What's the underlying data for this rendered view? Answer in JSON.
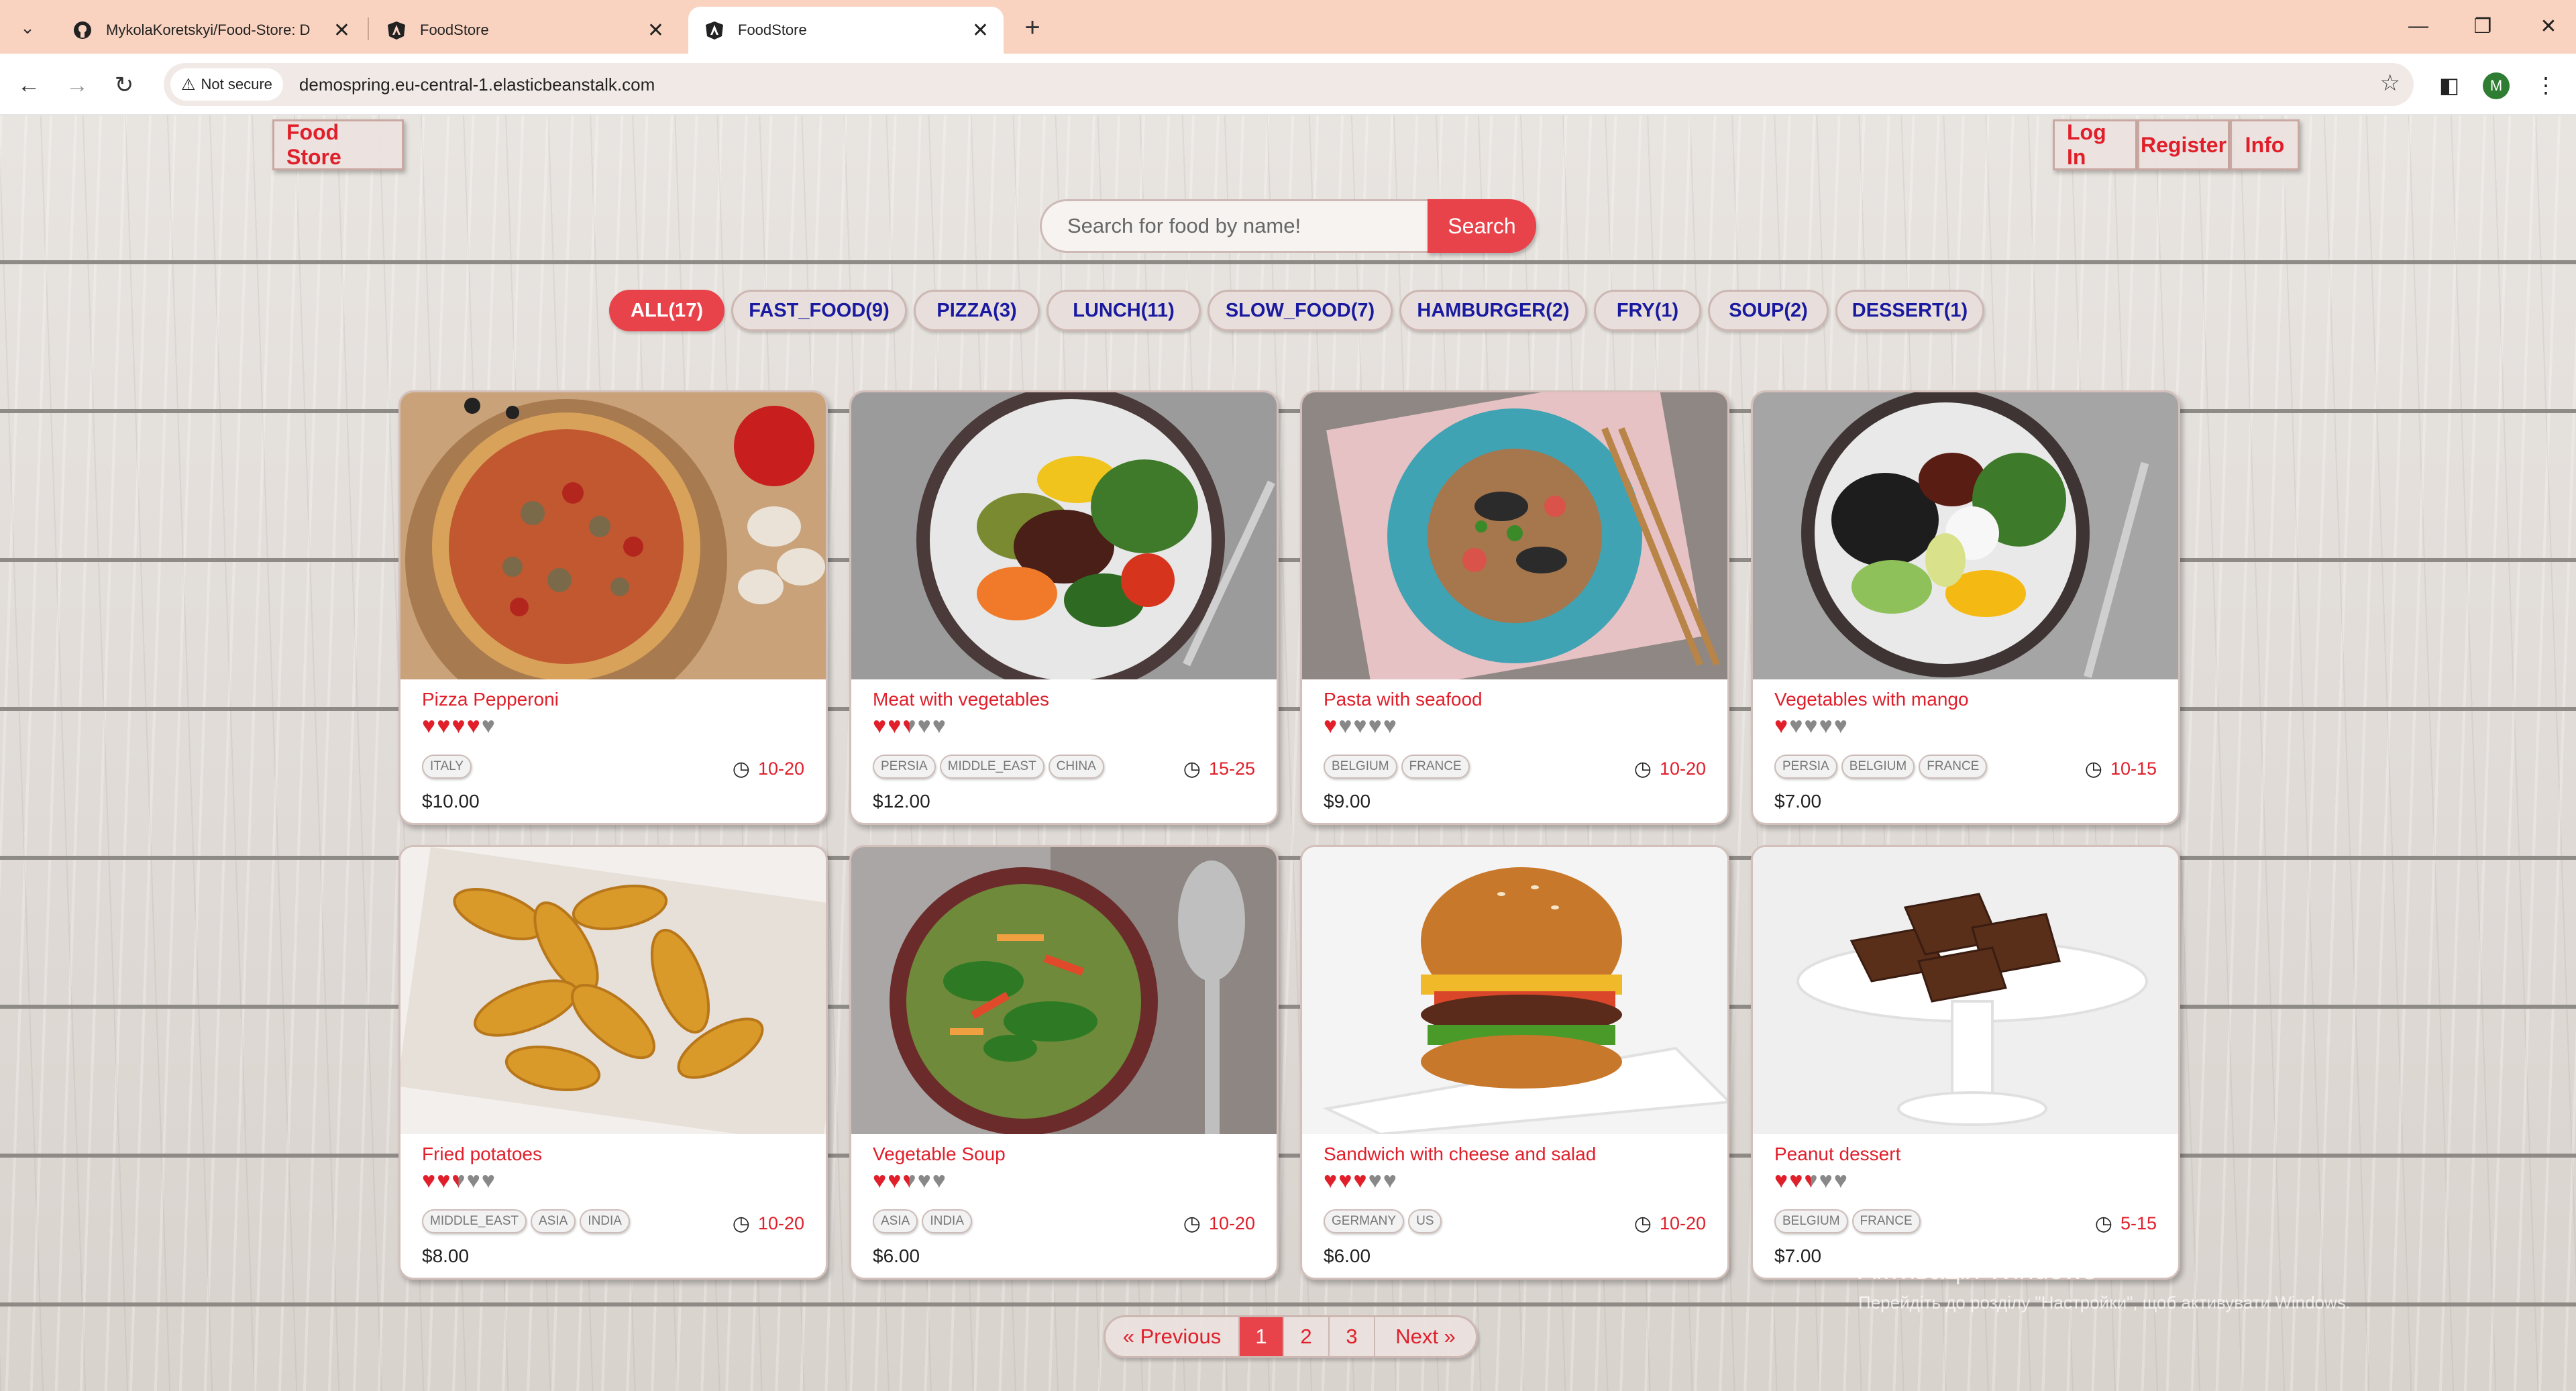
{
  "browser": {
    "tabs": [
      {
        "title": "MykolaKoretskyi/Food-Store: D",
        "icon": "github-icon",
        "active": false
      },
      {
        "title": "FoodStore",
        "icon": "angular-icon",
        "active": false
      },
      {
        "title": "FoodStore",
        "icon": "angular-icon",
        "active": true
      }
    ],
    "security_label": "Not secure",
    "url": "demospring.eu-central-1.elasticbeanstalk.com",
    "profile_initial": "M"
  },
  "header": {
    "brand": "Food Store",
    "login": "Log In",
    "register": "Register",
    "info": "Info"
  },
  "search": {
    "placeholder": "Search for food by name!",
    "button": "Search"
  },
  "tags": [
    {
      "label": "ALL(17)",
      "active": true
    },
    {
      "label": "FAST_FOOD(9)",
      "active": false
    },
    {
      "label": "PIZZA(3)",
      "active": false
    },
    {
      "label": "LUNCH(11)",
      "active": false
    },
    {
      "label": "SLOW_FOOD(7)",
      "active": false
    },
    {
      "label": "HAMBURGER(2)",
      "active": false
    },
    {
      "label": "FRY(1)",
      "active": false
    },
    {
      "label": "SOUP(2)",
      "active": false
    },
    {
      "label": "DESSERT(1)",
      "active": false
    }
  ],
  "foods": [
    {
      "name": "Pizza Pepperoni",
      "rating": 4,
      "origins": [
        "ITALY"
      ],
      "time": "10-20",
      "price": "$10.00",
      "image": "pizza"
    },
    {
      "name": "Meat with vegetables",
      "rating": 2.5,
      "origins": [
        "PERSIA",
        "MIDDLE_EAST",
        "CHINA"
      ],
      "time": "15-25",
      "price": "$12.00",
      "image": "meat-bowl"
    },
    {
      "name": "Pasta with seafood",
      "rating": 1,
      "origins": [
        "BELGIUM",
        "FRANCE"
      ],
      "time": "10-20",
      "price": "$9.00",
      "image": "pasta"
    },
    {
      "name": "Vegetables with mango",
      "rating": 1,
      "origins": [
        "PERSIA",
        "BELGIUM",
        "FRANCE"
      ],
      "time": "10-15",
      "price": "$7.00",
      "image": "veg-bowl"
    },
    {
      "name": "Fried potatoes",
      "rating": 2.5,
      "origins": [
        "MIDDLE_EAST",
        "ASIA",
        "INDIA"
      ],
      "time": "10-20",
      "price": "$8.00",
      "image": "potatoes"
    },
    {
      "name": "Vegetable Soup",
      "rating": 2.5,
      "origins": [
        "ASIA",
        "INDIA"
      ],
      "time": "10-20",
      "price": "$6.00",
      "image": "soup"
    },
    {
      "name": "Sandwich with cheese and salad",
      "rating": 3,
      "origins": [
        "GERMANY",
        "US"
      ],
      "time": "10-20",
      "price": "$6.00",
      "image": "burger"
    },
    {
      "name": "Peanut dessert",
      "rating": 2.5,
      "origins": [
        "BELGIUM",
        "FRANCE"
      ],
      "time": "5-15",
      "price": "$7.00",
      "image": "dessert"
    }
  ],
  "pagination": {
    "previous": "« Previous",
    "pages": [
      "1",
      "2",
      "3"
    ],
    "current": "1",
    "next": "Next »"
  },
  "watermark": {
    "line1": "Активація Windows",
    "line2": "Перейдіть до розділу \"Настройки\", щоб активувати Windows."
  },
  "colors": {
    "accent": "#e8434a",
    "brand_text": "#e01f2b",
    "tag_text": "#1a1aa0"
  }
}
